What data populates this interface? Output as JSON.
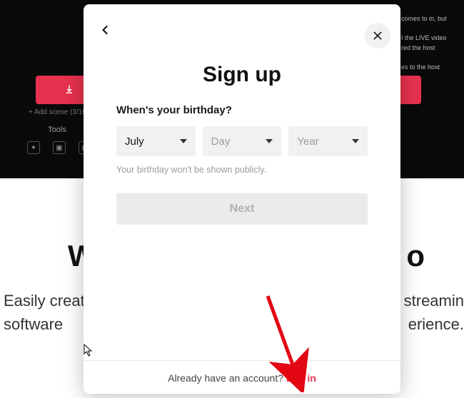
{
  "background": {
    "tools_label": "Tools",
    "add_scene": "+  Add scene (3/10)",
    "heading_left": "W",
    "heading_right": "o",
    "sub_left_1": "Easily creat",
    "sub_left_2": "software",
    "sub_right_1": "e streamin",
    "sub_right_2": "erience.",
    "right_lines": "comes to in, but\n\nI the LIVE video\nred the host\n\nes to the host"
  },
  "modal": {
    "title": "Sign up",
    "birthday_label": "When's your birthday?",
    "month": {
      "value": "July"
    },
    "day": {
      "placeholder": "Day"
    },
    "year": {
      "placeholder": "Year"
    },
    "hint": "Your birthday won't be shown publicly.",
    "next_label": "Next",
    "footer_text": "Already have an account? ",
    "login_link": "Log in"
  }
}
